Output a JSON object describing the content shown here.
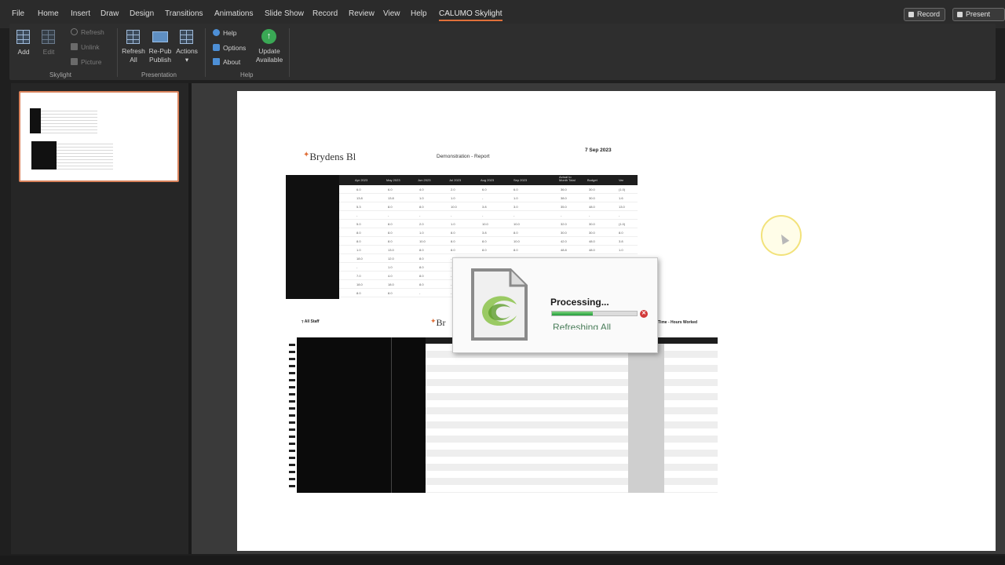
{
  "menu": {
    "tabs": [
      "File",
      "Home",
      "Insert",
      "Draw",
      "Design",
      "Transitions",
      "Animations",
      "Slide Show",
      "Record",
      "Review",
      "View",
      "Help",
      "CALUMO Skylight"
    ],
    "active_tab": "CALUMO Skylight",
    "record_button": "Record",
    "present_button": "Present"
  },
  "ribbon": {
    "skylight": {
      "add": "Add",
      "edit": "Edit",
      "refresh": "Refresh",
      "unlink": "Unlink",
      "picture": "Picture",
      "label": "Skylight"
    },
    "presentation": {
      "refresh_all": [
        "Refresh",
        "All"
      ],
      "re_publish": [
        "Re-Pub",
        "Publish"
      ],
      "actions": "Actions",
      "label": "Presentation"
    },
    "help": {
      "help": "Help",
      "options": "Options",
      "about": "About",
      "update": [
        "Update",
        "Available"
      ],
      "label": "Help"
    }
  },
  "slide": {
    "logo": "Brydens Bl",
    "report_title": "Demonstration - Report",
    "report_date": "7 Sep 2023",
    "table1_headers": [
      "Apr 2023",
      "May 2023",
      "Jun 2023",
      "Jul 2023",
      "Aug 2023",
      "Sep 2023",
      "Actual to Month Total",
      "Budget",
      "Var"
    ],
    "table1_rows": [
      [
        "6.0",
        "6.0",
        "4.0",
        "2.0",
        "6.0",
        "6.0",
        "36.0",
        "30.0",
        "(1.0)"
      ],
      [
        "13.8",
        "13.8",
        "1.0",
        "1.0",
        "-",
        "1.0",
        "38.0",
        "30.0",
        "1.6"
      ],
      [
        "5.3",
        "8.0",
        "8.0",
        "10.0",
        "3.8",
        "3.0",
        "35.0",
        "48.0",
        "13.0"
      ],
      [
        "-",
        "-",
        "-",
        "-",
        "-",
        "-",
        "-",
        "-",
        "-"
      ],
      [
        "5.0",
        "8.0",
        "2.0",
        "1.0",
        "10.0",
        "10.0",
        "32.0",
        "30.0",
        "(1.0)"
      ],
      [
        "8.0",
        "8.0",
        "1.0",
        "8.0",
        "3.8",
        "8.0",
        "30.0",
        "30.0",
        "8.0"
      ],
      [
        "8.0",
        "8.0",
        "10.0",
        "8.0",
        "8.0",
        "10.0",
        "42.0",
        "48.0",
        "3.8"
      ],
      [
        "1.0",
        "13.0",
        "8.0",
        "8.0",
        "8.0",
        "8.0",
        "48.8",
        "48.0",
        "1.0"
      ],
      [
        "18.0",
        "12.0",
        "8.0",
        "-",
        "-",
        "-",
        "-",
        "-",
        "-"
      ],
      [
        "-",
        "1.0",
        "8.0",
        "-",
        "-",
        "-",
        "-",
        "-",
        "-"
      ],
      [
        "7.0",
        "4.0",
        "8.0",
        "-",
        "-",
        "-",
        "-",
        "-",
        "-"
      ],
      [
        "18.0",
        "18.0",
        "8.0",
        "-",
        "-",
        "-",
        "-",
        "-",
        "-"
      ],
      [
        "8.0",
        "8.0",
        "-",
        "-",
        "-",
        "-",
        "-",
        "-",
        "-"
      ]
    ],
    "section2_title": "All Staff",
    "section2_right_title": "Time - Hours Worked"
  },
  "dialog": {
    "title": "Processing...",
    "status": "Refreshing All",
    "progress": 0.48,
    "cancel_icon": "cancel-icon"
  },
  "colors": {
    "accent": "#e0703a",
    "progress": "#1f9b3a",
    "cancel": "#d23a3a"
  }
}
